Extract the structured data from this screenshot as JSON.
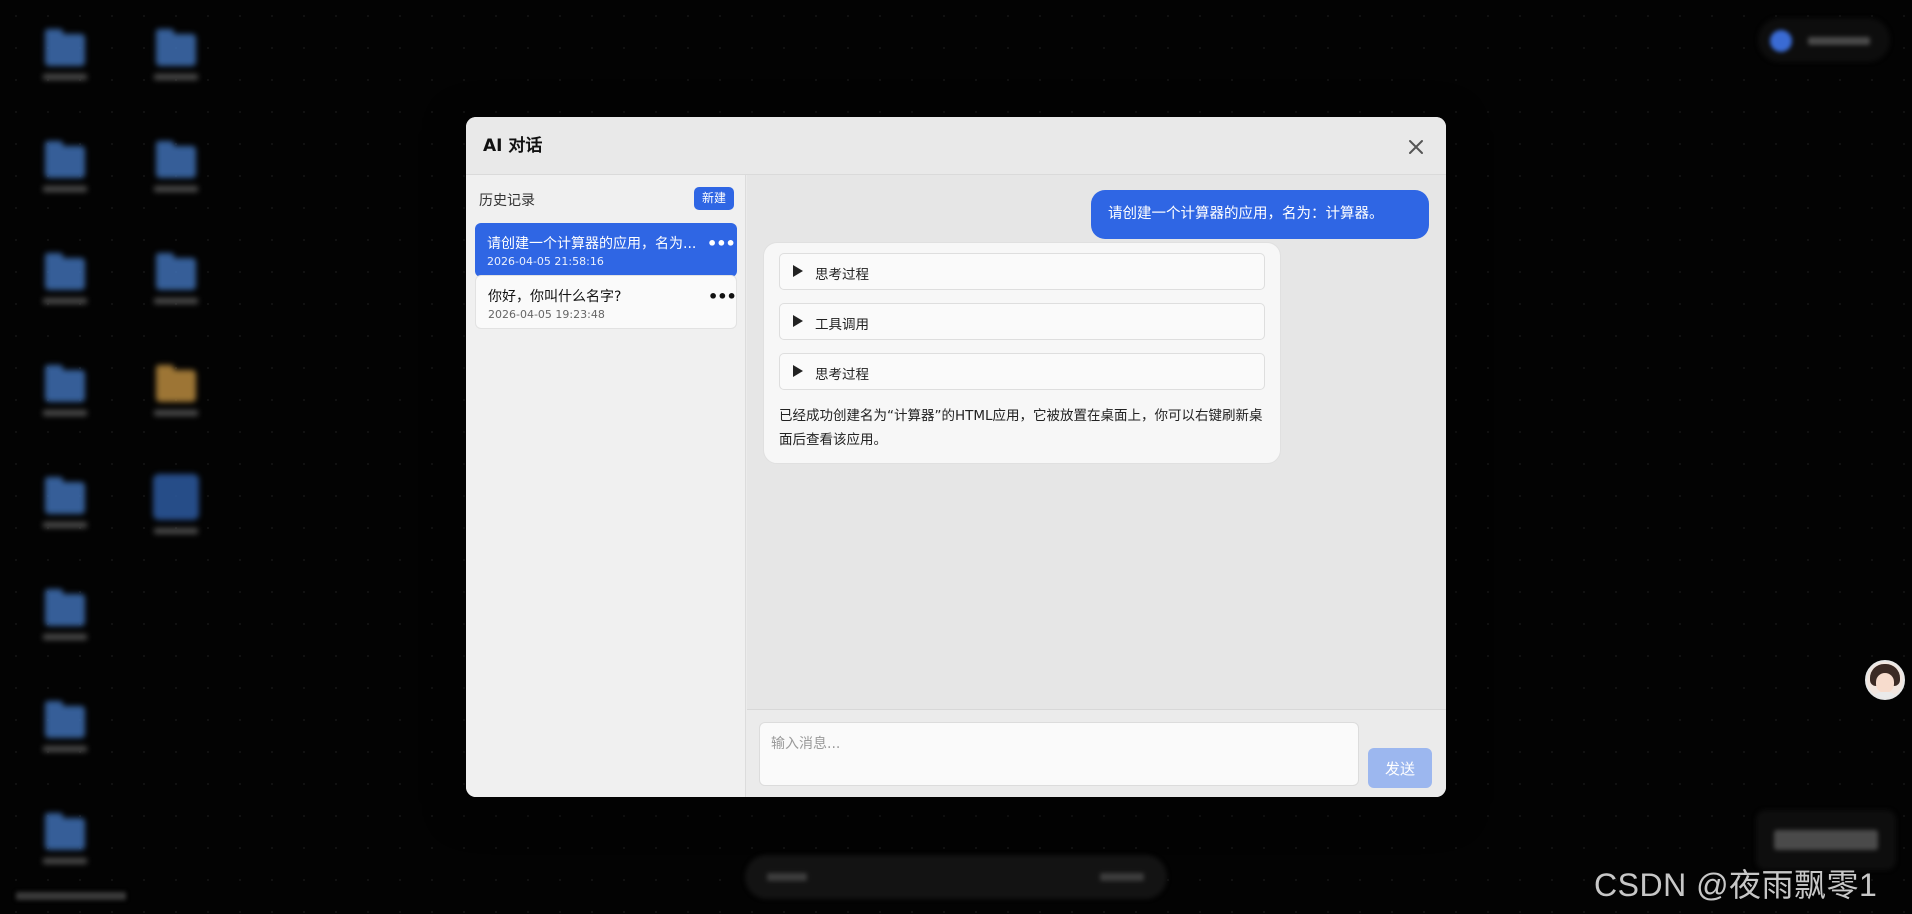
{
  "modal": {
    "title": "AI 对话"
  },
  "sidebar": {
    "history_title": "历史记录",
    "new_label": "新建",
    "conversations": [
      {
        "title": "请创建一个计算器的应用，名为...",
        "date": "2026-04-05 21:58:16",
        "active": true
      },
      {
        "title": "你好，你叫什么名字?",
        "date": "2026-04-05 19:23:48",
        "active": false
      }
    ]
  },
  "chat": {
    "user_message": "请创建一个计算器的应用，名为：计算器。",
    "steps": [
      {
        "label": "思考过程"
      },
      {
        "label": "工具调用"
      },
      {
        "label": "思考过程"
      }
    ],
    "assistant_message": "已经成功创建名为“计算器”的HTML应用，它被放置在桌面上，你可以右键刷新桌面后查看该应用。"
  },
  "composer": {
    "placeholder": "输入消息...",
    "send_label": "发送"
  },
  "watermark": "CSDN @夜雨飘零1",
  "colors": {
    "accent": "#2f66e4",
    "send_disabled": "#9cb7ef"
  }
}
